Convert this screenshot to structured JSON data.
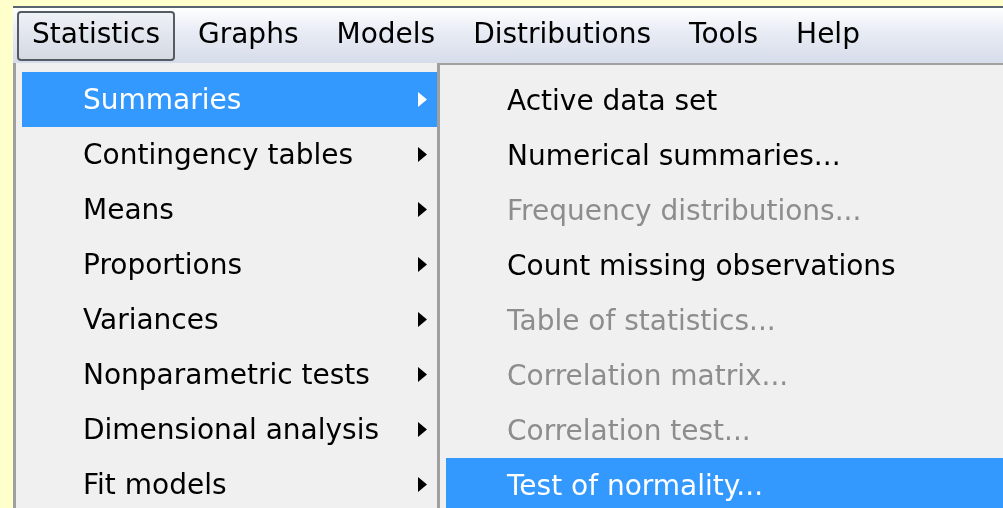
{
  "menubar": [
    {
      "label": "Statistics",
      "selected": true
    },
    {
      "label": "Graphs",
      "selected": false
    },
    {
      "label": "Models",
      "selected": false
    },
    {
      "label": "Distributions",
      "selected": false
    },
    {
      "label": "Tools",
      "selected": false
    },
    {
      "label": "Help",
      "selected": false
    }
  ],
  "menu": {
    "items": [
      {
        "label": "Summaries",
        "selected": true,
        "has_submenu": true
      },
      {
        "label": "Contingency tables",
        "selected": false,
        "has_submenu": true
      },
      {
        "label": "Means",
        "selected": false,
        "has_submenu": true
      },
      {
        "label": "Proportions",
        "selected": false,
        "has_submenu": true
      },
      {
        "label": "Variances",
        "selected": false,
        "has_submenu": true
      },
      {
        "label": "Nonparametric tests",
        "selected": false,
        "has_submenu": true
      },
      {
        "label": "Dimensional analysis",
        "selected": false,
        "has_submenu": true
      },
      {
        "label": "Fit models",
        "selected": false,
        "has_submenu": true
      }
    ]
  },
  "submenu": {
    "items": [
      {
        "label": "Active data set",
        "selected": false,
        "disabled": false
      },
      {
        "label": "Numerical summaries...",
        "selected": false,
        "disabled": false
      },
      {
        "label": "Frequency distributions...",
        "selected": false,
        "disabled": true
      },
      {
        "label": "Count missing observations",
        "selected": false,
        "disabled": false
      },
      {
        "label": "Table of statistics...",
        "selected": false,
        "disabled": true
      },
      {
        "label": "Correlation matrix...",
        "selected": false,
        "disabled": true
      },
      {
        "label": "Correlation test...",
        "selected": false,
        "disabled": true
      },
      {
        "label": "Test of normality...",
        "selected": true,
        "disabled": false
      }
    ]
  }
}
